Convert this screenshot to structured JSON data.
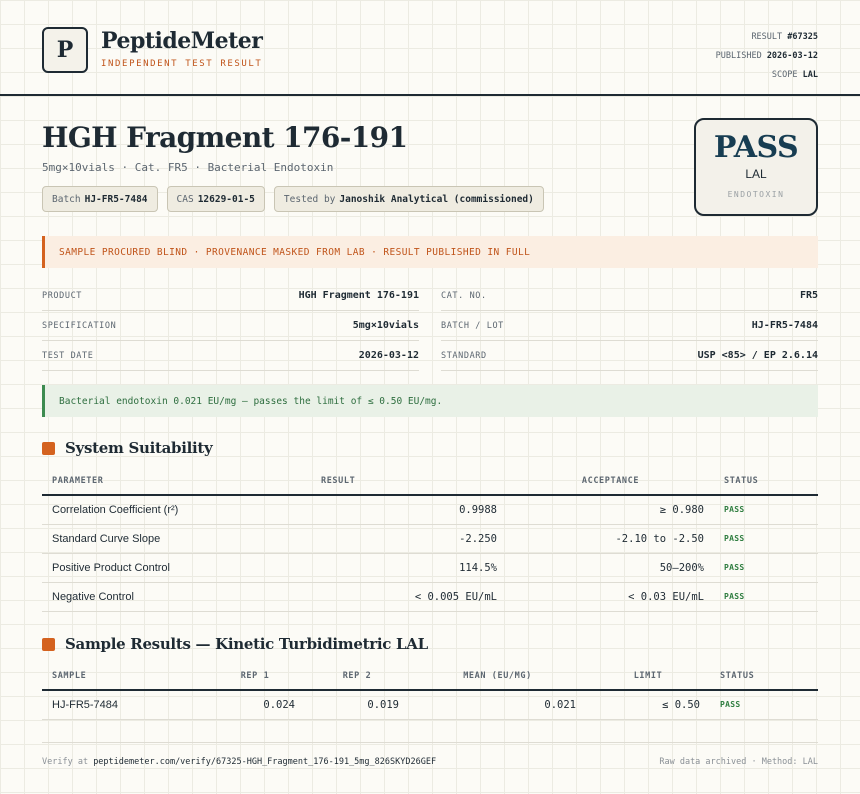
{
  "brand": {
    "logo_letter": "P",
    "name": "PeptideMeter",
    "tagline": "INDEPENDENT TEST RESULT"
  },
  "meta": {
    "result_label": "RESULT",
    "result_value": "#67325",
    "published_label": "PUBLISHED",
    "published_value": "2026-03-12",
    "scope_label": "SCOPE",
    "scope_value": "LAL"
  },
  "product": {
    "title": "HGH Fragment 176-191",
    "subtitle": "5mg×10vials · Cat. FR5 · Bacterial Endotoxin",
    "chips": [
      {
        "label": "Batch",
        "value": "HJ-FR5-7484"
      },
      {
        "label": "CAS",
        "value": "12629-01-5"
      },
      {
        "label": "Tested by",
        "value": "Janoshik Analytical (commissioned)"
      }
    ]
  },
  "stamp": {
    "verdict": "PASS",
    "method": "LAL",
    "test": "ENDOTOXIN"
  },
  "notice": "SAMPLE PROCURED BLIND · PROVENANCE MASKED FROM LAB · RESULT PUBLISHED IN FULL",
  "details": {
    "product_label": "PRODUCT",
    "product_value": "HGH Fragment 176-191",
    "cat_label": "CAT. NO.",
    "cat_value": "FR5",
    "spec_label": "SPECIFICATION",
    "spec_value": "5mg×10vials",
    "batch_label": "BATCH / LOT",
    "batch_value": "HJ-FR5-7484",
    "date_label": "TEST DATE",
    "date_value": "2026-03-12",
    "standard_label": "STANDARD",
    "standard_value": "USP <85> / EP 2.6.14"
  },
  "result_banner": "Bacterial endotoxin 0.021 EU/mg — passes the limit of ≤ 0.50 EU/mg.",
  "suitability": {
    "title": "System Suitability",
    "headers": [
      "PARAMETER",
      "RESULT",
      "ACCEPTANCE",
      "STATUS"
    ],
    "rows": [
      {
        "parameter": "Correlation Coefficient (r²)",
        "result": "0.9988",
        "acceptance": "≥ 0.980",
        "status": "PASS"
      },
      {
        "parameter": "Standard Curve Slope",
        "result": "-2.250",
        "acceptance": "-2.10 to -2.50",
        "status": "PASS"
      },
      {
        "parameter": "Positive Product Control",
        "result": "114.5%",
        "acceptance": "50–200%",
        "status": "PASS"
      },
      {
        "parameter": "Negative Control",
        "result": "< 0.005 EU/mL",
        "acceptance": "< 0.03 EU/mL",
        "status": "PASS"
      }
    ]
  },
  "samples": {
    "title": "Sample Results — Kinetic Turbidimetric LAL",
    "headers": [
      "SAMPLE",
      "REP 1",
      "REP 2",
      "MEAN (EU/MG)",
      "LIMIT",
      "STATUS"
    ],
    "rows": [
      {
        "sample": "HJ-FR5-7484",
        "rep1": "0.024",
        "rep2": "0.019",
        "mean": "0.021",
        "limit": "≤ 0.50",
        "status": "PASS"
      }
    ]
  },
  "footer": {
    "verify_label": "Verify at",
    "verify_url": "peptidemeter.com/verify/67325-HGH_Fragment_176-191_5mg_826SKYD26GEF",
    "archive_note": "Raw data archived · Method: LAL"
  }
}
